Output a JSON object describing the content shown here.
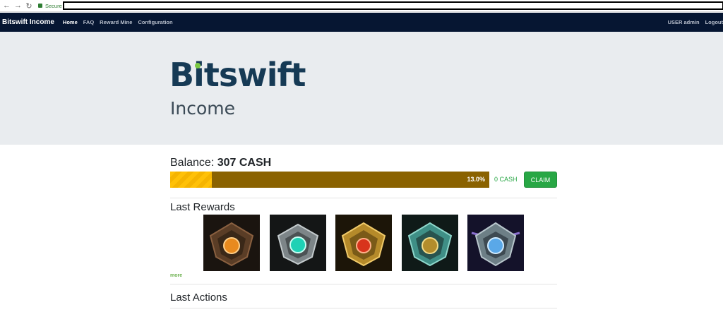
{
  "browser": {
    "secure_label": "Secure",
    "back_icon": "back-arrow-icon",
    "forward_icon": "forward-arrow-icon",
    "reload_icon": "reload-icon"
  },
  "navbar": {
    "brand": "Bitswift Income",
    "links": [
      "Home",
      "FAQ",
      "Reward Mine",
      "Configuration"
    ],
    "user": "USER admin",
    "logout": "Logout"
  },
  "hero": {
    "logo_text": "Bitswift",
    "subtitle": "Income",
    "brand_color": "#163a55",
    "accent_color": "#7bc943"
  },
  "balance": {
    "label": "Balance:",
    "value": "307 CASH"
  },
  "progress": {
    "percent_label": "13.0%",
    "fraction": 0.13,
    "pending": "0 CASH",
    "claim_label": "CLAIM"
  },
  "rewards": {
    "heading": "Last Rewards",
    "items": [
      {
        "icon": "bronze-emblem-icon",
        "gem": "#e88a1e",
        "metal": "#6b4a30"
      },
      {
        "icon": "silver-emblem-icon",
        "gem": "#1fd1b5",
        "metal": "#9aa3a6"
      },
      {
        "icon": "gold-emblem-icon",
        "gem": "#d8341c",
        "metal": "#c99a2e"
      },
      {
        "icon": "platinum-emblem-icon",
        "gem": "#b38d2c",
        "metal": "#3f8f86"
      },
      {
        "icon": "diamond-emblem-icon",
        "gem": "#5aa8e8",
        "metal": "#8a6fcf"
      }
    ],
    "more_label": "more"
  },
  "actions": {
    "heading": "Last Actions"
  }
}
